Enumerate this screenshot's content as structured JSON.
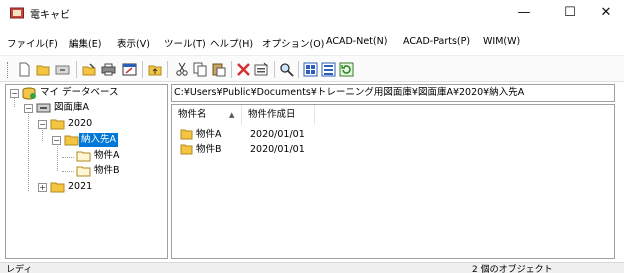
{
  "window": {
    "title": "電キャビ",
    "minimize_glyph": "—",
    "maximize_glyph": "☐",
    "close_glyph": "✕"
  },
  "menu": [
    {
      "label": "ファイル(F)"
    },
    {
      "label": "編集(E)"
    },
    {
      "label": "表示(V)"
    },
    {
      "label": "ツール(T)"
    },
    {
      "label": "ヘルプ(H)"
    },
    {
      "label": "オプション(O)"
    },
    {
      "label": "ACAD-Net(N)"
    },
    {
      "label": "ACAD-Parts(P)"
    },
    {
      "label": "WIM(W)"
    }
  ],
  "toolbar": {
    "buttons": [
      "new-icon",
      "open-folder-icon",
      "drawer-icon",
      "edit-folder-icon",
      "print-icon",
      "frame-icon",
      "up-folder-icon",
      "cut-icon",
      "copy-icon",
      "paste-icon",
      "delete-icon",
      "properties-icon",
      "search-icon",
      "view-large-icon",
      "view-details-icon",
      "refresh-icon"
    ]
  },
  "tree": {
    "root": "マイ データベース",
    "library": "図面庫A",
    "year_2020": "2020",
    "client": "納入先A",
    "item_a": "物件A",
    "item_b": "物件B",
    "year_2021": "2021"
  },
  "path": "C:¥Users¥Public¥Documents¥トレーニング用図面庫¥図面庫A¥2020¥納入先A",
  "list": {
    "columns": [
      "物件名",
      "物件作成日"
    ],
    "sort_indicator": "▲",
    "rows": [
      {
        "name": "物件A",
        "date": "2020/01/01"
      },
      {
        "name": "物件B",
        "date": "2020/01/01"
      }
    ]
  },
  "status": {
    "left": "レディ",
    "right": "2 個のオブジェクト"
  },
  "colors": {
    "selection": "#0078d7",
    "folder": "#f5c542"
  }
}
